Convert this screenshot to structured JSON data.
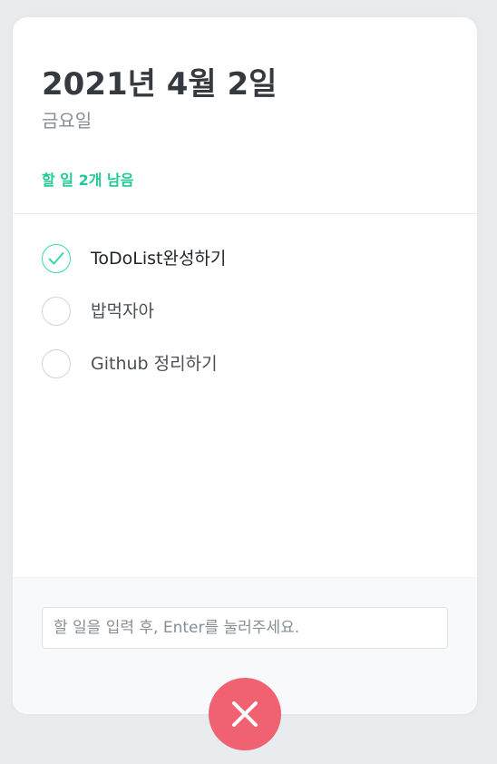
{
  "header": {
    "date": "2021년 4월 2일",
    "day": "금요일",
    "tasks_left": "할 일 2개 남음"
  },
  "todos": [
    {
      "text": "ToDoList완성하기",
      "done": true
    },
    {
      "text": "밥먹자아",
      "done": false
    },
    {
      "text": "Github 정리하기",
      "done": false
    }
  ],
  "input": {
    "placeholder": "할 일을 입력 후, Enter를 눌러주세요.",
    "value": ""
  },
  "icons": {
    "check": "check-icon",
    "close": "close-icon"
  },
  "colors": {
    "accent": "#20c997",
    "check_border": "#38d9a9",
    "close_button": "#f06172",
    "background": "#e9ecef"
  }
}
